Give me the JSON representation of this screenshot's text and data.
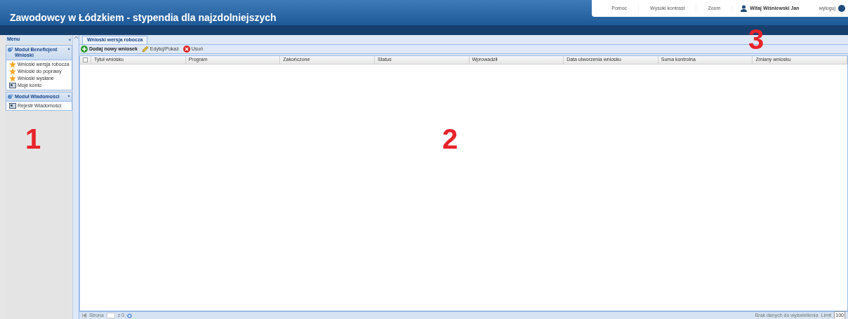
{
  "header": {
    "title": "Zawodowcy w Łódzkiem - stypendia dla najzdolniejszych",
    "links": [
      {
        "label": "Pomoc",
        "kind": "link"
      },
      {
        "label": "Wysoki kontrast",
        "kind": "link"
      },
      {
        "label": "Zoom",
        "kind": "link"
      },
      {
        "label": "Witaj Wiśniewski Jan",
        "kind": "user"
      },
      {
        "label": "wyloguj",
        "kind": "logout"
      }
    ]
  },
  "sidebar": {
    "title": "Menu",
    "collapse": "«",
    "groups": [
      {
        "title": "Moduł Beneficjent Wnioski",
        "toggle": "«",
        "items": [
          {
            "label": "Wnioski wersja robocza",
            "kind": "star"
          },
          {
            "label": "Wnioski do poprawy",
            "kind": "star"
          },
          {
            "label": "Wnioski wysłane",
            "kind": "star"
          },
          {
            "label": "Moje konto",
            "kind": "card"
          }
        ]
      },
      {
        "title": "Moduł Wiadomości",
        "toggle": "«",
        "items": [
          {
            "label": "Rejestr Wiadomości",
            "kind": "card"
          }
        ]
      }
    ]
  },
  "tabs": [
    {
      "label": "Wnioski wersja robocza",
      "selected": true
    }
  ],
  "toolbar": [
    {
      "label": "Dodaj nowy wniosek",
      "kind": "add"
    },
    {
      "label": "Edytuj/Pokaż",
      "kind": "edit"
    },
    {
      "label": "Usuń",
      "kind": "delete"
    }
  ],
  "table": {
    "select_all_checked": false,
    "columns": [
      "Tytuł wniosku",
      "Program",
      "Zakończone",
      "Status",
      "Wprowadził",
      "Data utworzenia wniosku",
      "Suma kontrolna",
      "Zmiany wniosku"
    ]
  },
  "pager": {
    "page_label": "Strona",
    "of": "z 0",
    "empty": "Brak danych do wyświetlenia",
    "limit_label": "Limit",
    "limit": "100"
  },
  "annotations": [
    "1",
    "2",
    "3"
  ]
}
